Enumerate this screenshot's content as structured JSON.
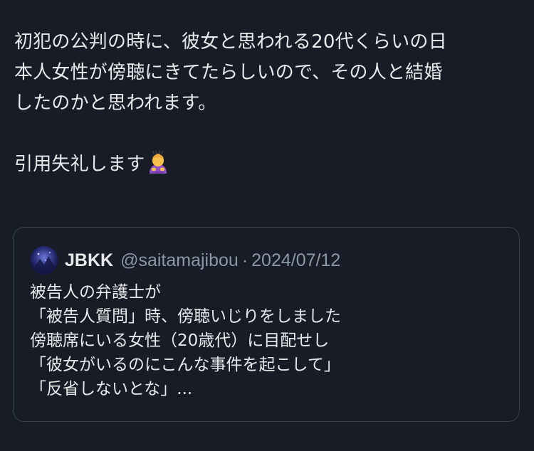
{
  "tweet": {
    "lines": [
      "初犯の公判の時に、彼女と思われる20代くらいの日",
      "本人女性が傍聴にきてたらしいので、その人と結婚",
      "したのかと思われます。"
    ],
    "second_paragraph": "引用失礼します",
    "emoji_icon": "person-bowing-emoji"
  },
  "quote": {
    "display_name": "JBKK",
    "handle": "@saitamajibou",
    "separator": "·",
    "date": "2024/07/12",
    "lines": [
      "被告人の弁護士が",
      "「被告人質問」時、傍聴いじりをしました",
      "傍聴席にいる女性（20歳代）に目配せし",
      "「彼女がいるのにこんな事件を起こして」",
      "「反省しないとな」..."
    ]
  },
  "colors": {
    "background": "#171c27",
    "text": "#e7e9ea",
    "secondary_text": "#8b98a5",
    "card_border": "#38444d"
  }
}
